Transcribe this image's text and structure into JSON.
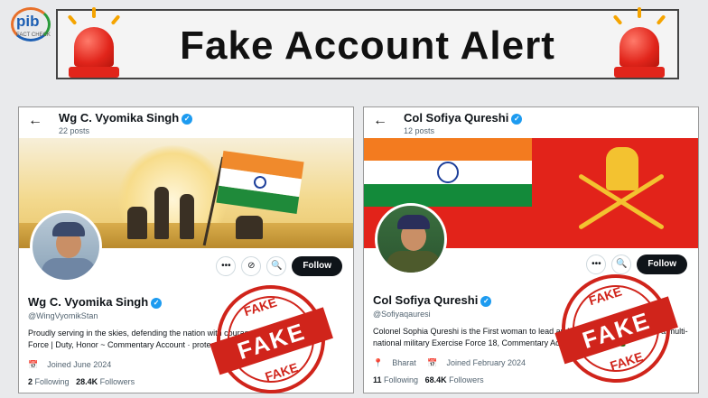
{
  "header": {
    "logo_text": "pib",
    "logo_sub": "FACT CHECK",
    "title": "Fake Account Alert"
  },
  "stamp_text": "FAKE",
  "cards": [
    {
      "top_name": "Wg C. Vyomika Singh",
      "posts": "22 posts",
      "name": "Wg C. Vyomika Singh",
      "handle": "@WingVyomikStan",
      "bio": "Proudly serving in the skies, defending the nation with courage and honor. Indian Air Force | Duty, Honor ~ Commentary Account · protecting the motherland",
      "joined": "Joined June 2024",
      "following_count": "2",
      "following_label": "Following",
      "followers_count": "28.4K",
      "followers_label": "Followers",
      "follow_label": "Follow"
    },
    {
      "top_name": "Col Sofiya Qureshi",
      "posts": "12 posts",
      "name": "Col Sofiya Qureshi",
      "handle": "@Sofiyaqauresi",
      "bio": "Colonel Sophia Qureshi is the First woman to lead an Indian Army contingent at a multi-national military Exercise Force 18, Commentary Account, Jai Hind 🇮🇳",
      "location": "Bharat",
      "joined": "Joined February 2024",
      "following_count": "11",
      "following_label": "Following",
      "followers_count": "68.4K",
      "followers_label": "Followers",
      "follow_label": "Follow"
    }
  ],
  "icons": {
    "back": "←",
    "more": "•••",
    "grok": "⊘",
    "search": "🔍",
    "calendar": "📅",
    "location": "📍",
    "verified": "✓"
  },
  "colors": {
    "alert_red": "#e1251b",
    "stamp_red": "#d0241b",
    "verified_blue": "#1d9bf0"
  }
}
